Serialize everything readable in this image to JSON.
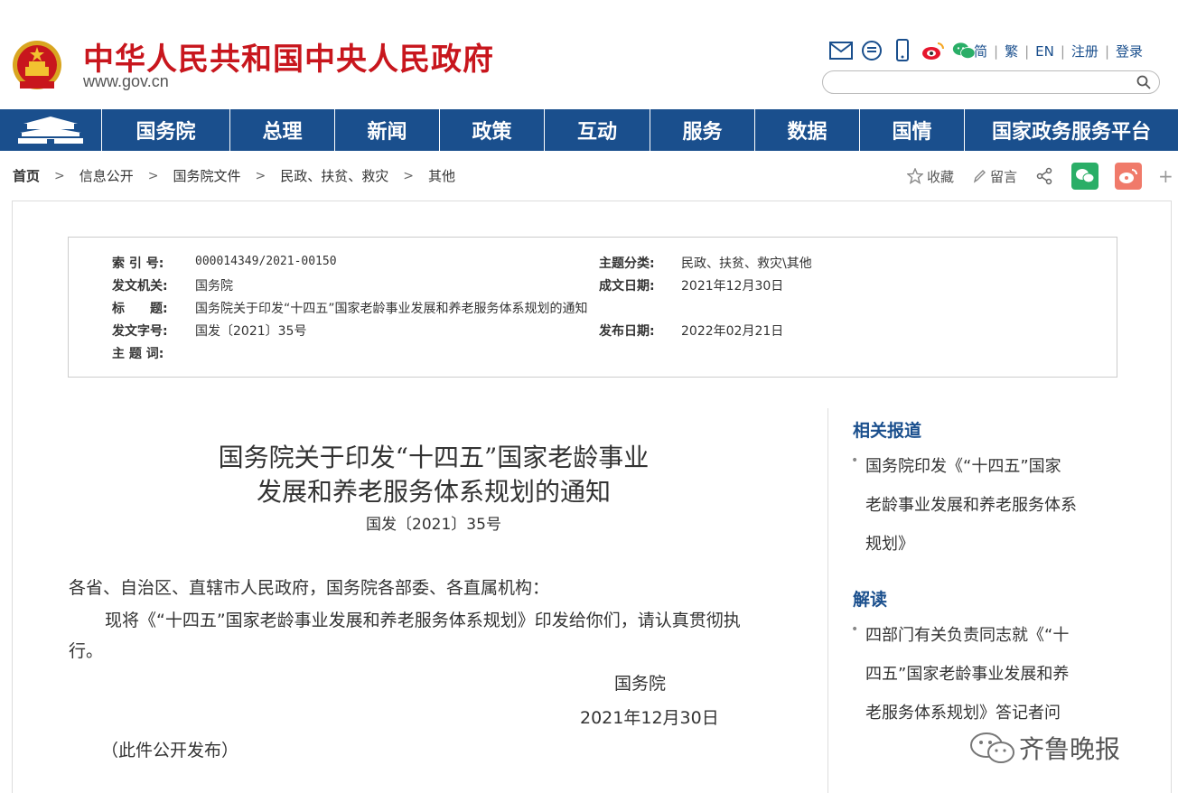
{
  "header": {
    "site_title": "中华人民共和国中央人民政府",
    "site_url": "www.gov.cn",
    "top_links": [
      "简",
      "繁",
      "EN",
      "注册",
      "登录"
    ],
    "search_placeholder": ""
  },
  "nav": {
    "items": [
      "国务院",
      "总理",
      "新闻",
      "政策",
      "互动",
      "服务",
      "数据",
      "国情",
      "国家政务服务平台"
    ]
  },
  "breadcrumb": {
    "items": [
      "首页",
      "信息公开",
      "国务院文件",
      "民政、扶贫、救灾",
      "其他"
    ],
    "sep": ">"
  },
  "tools": {
    "favorite": "收藏",
    "comment": "留言",
    "more": "+"
  },
  "meta": {
    "index_key": "索 引 号:",
    "index_val": "000014349/2021-00150",
    "topic_key": "主题分类:",
    "topic_val": "民政、扶贫、救灾\\其他",
    "issuer_key": "发文机关:",
    "issuer_val": "国务院",
    "date_key": "成文日期:",
    "date_val": "2021年12月30日",
    "title_key": "标　　题:",
    "title_val": "国务院关于印发“十四五”国家老龄事业发展和养老服务体系规划的通知",
    "docno_key": "发文字号:",
    "docno_val": "国发〔2021〕35号",
    "pubdate_key": "发布日期:",
    "pubdate_val": "2022年02月21日",
    "keywords_key": "主 题 词:",
    "keywords_val": ""
  },
  "doc": {
    "title_line1": "国务院关于印发“十四五”国家老龄事业",
    "title_line2": "发展和养老服务体系规划的通知",
    "number": "国发〔2021〕35号",
    "salutation": "各省、自治区、直辖市人民政府，国务院各部委、各直属机构：",
    "body_line1": "现将《“十四五”国家老龄事业发展和养老服务体系规划》印发给你们，请认真贯彻执",
    "body_line2": "行。",
    "signer": "国务院",
    "sign_date": "2021年12月30日",
    "note": "（此件公开发布）"
  },
  "sidebar": {
    "related_title": "相关报道",
    "related_lines": [
      "国务院印发《“十四五”国家",
      "老龄事业发展和养老服务体系",
      "规划》"
    ],
    "interp_title": "解读",
    "interp_lines": [
      "四部门有关负责同志就《“十",
      "四五”国家老龄事业发展和养",
      "老服务体系规划》答记者问"
    ]
  },
  "watermark": {
    "text": "齐鲁晚报"
  },
  "colors": {
    "brand_red": "#c8161d",
    "nav_blue": "#1a4f8d",
    "wechat_green": "#2aae67",
    "weibo_red": "#e6162d"
  }
}
